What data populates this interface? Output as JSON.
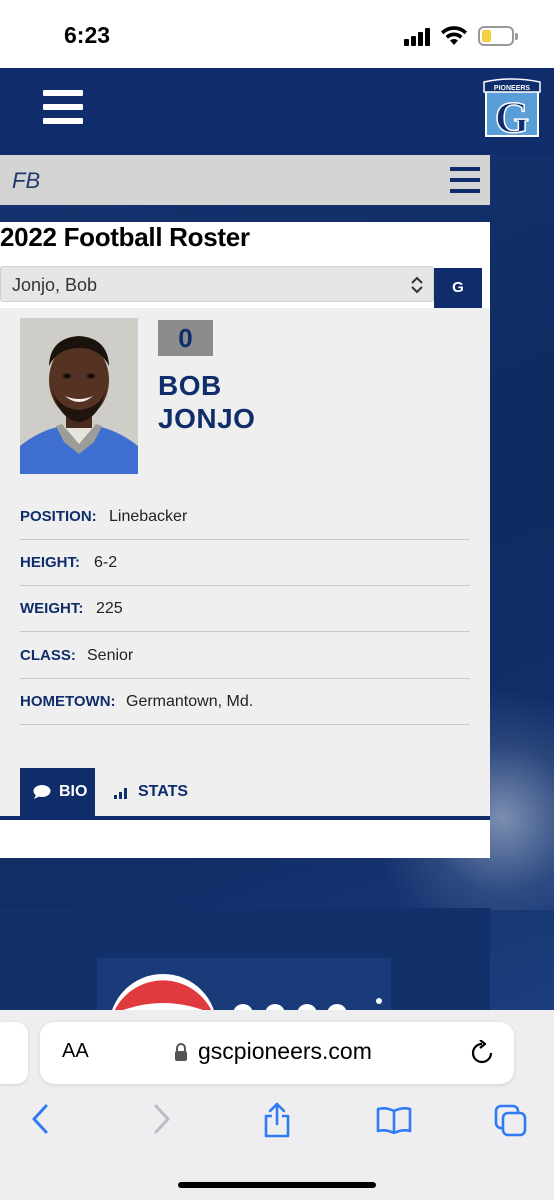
{
  "status_bar": {
    "time": "6:23"
  },
  "site": {
    "logo_text": "PIONEERS",
    "logo_letter": "G"
  },
  "sub_header": {
    "title": "FB"
  },
  "roster": {
    "title": "2022 Football Roster",
    "selected_player": "Jonjo, Bob",
    "go_label": "G"
  },
  "player": {
    "number": "0",
    "first_name": "BOB",
    "last_name": "JONJO",
    "details": [
      {
        "label": "POSITION:",
        "value": "Linebacker"
      },
      {
        "label": "HEIGHT:",
        "value": "6-2"
      },
      {
        "label": "WEIGHT:",
        "value": "225"
      },
      {
        "label": "CLASS:",
        "value": "Senior"
      },
      {
        "label": "HOMETOWN:",
        "value": "Germantown, Md."
      }
    ]
  },
  "tabs": [
    {
      "label": "BIO",
      "icon": "speech-bubble-icon",
      "active": true
    },
    {
      "label": "STATS",
      "icon": "bar-chart-icon",
      "active": false
    }
  ],
  "browser": {
    "aa_label": "AA",
    "url": "gscpioneers.com"
  },
  "colors": {
    "brand_navy": "#0f2d6b",
    "sub_header_gray": "#d4d4d4",
    "jersey_badge_gray": "#8c8c8c"
  }
}
